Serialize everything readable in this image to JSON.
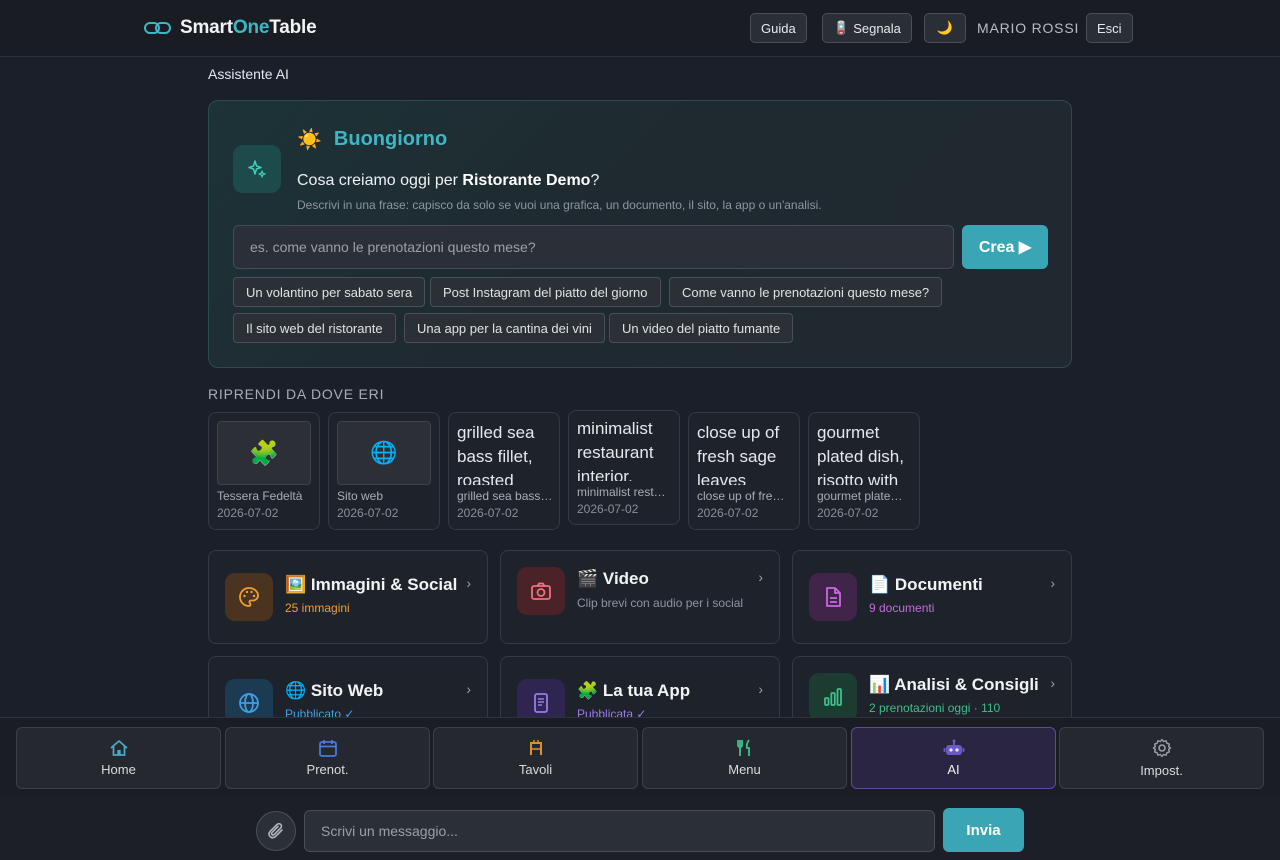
{
  "header": {
    "brand_a": "Smart",
    "brand_b": "One",
    "brand_c": "Table",
    "guide_label": "Guida",
    "report_icon": "🪫",
    "report_label": "Segnala",
    "theme_icon": "🌙",
    "user_name": "MARIO ROSSI",
    "logout_label": "Esci"
  },
  "page_title": "Assistente AI",
  "hero": {
    "greet_icon": "☀️",
    "greeting": "Buongiorno",
    "question_pre": "Cosa creiamo oggi per ",
    "restaurant": "Ristorante Demo",
    "question_post": "?",
    "subtitle": "Descrivi in una frase: capisco da solo se vuoi una grafica, un documento, il sito, la app o un'analisi.",
    "input_placeholder": "es. come vanno le prenotazioni questo mese?",
    "create_label": "Crea ▶",
    "suggestions": [
      "Un volantino per sabato sera",
      "Post Instagram del piatto del giorno",
      "Come vanno le prenotazioni questo mese?",
      "Il sito web del ristorante",
      "Una app per la cantina dei vini",
      "Un video del piatto fumante"
    ]
  },
  "recent": {
    "label": "RIPRENDI DA DOVE ERI",
    "items": [
      {
        "icon": "🧩",
        "name": "Tessera Fedeltà",
        "date": "2026-07-02"
      },
      {
        "icon": "🌐",
        "name": "Sito web",
        "date": "2026-07-02"
      },
      {
        "alt": "grilled sea bass fillet, roasted",
        "name": "grilled sea bass…",
        "date": "2026-07-02"
      },
      {
        "alt": "minimalist restaurant interior, sage",
        "name": "minimalist rest…",
        "date": "2026-07-02"
      },
      {
        "alt": "close up of fresh sage leaves",
        "name": "close up of fre…",
        "date": "2026-07-02"
      },
      {
        "alt": "gourmet plated dish, risotto with",
        "name": "gourmet plate…",
        "date": "2026-07-02"
      }
    ]
  },
  "categories": [
    {
      "emoji": "🖼️",
      "title": "Immagini & Social",
      "sub": "25 immagini",
      "sub_color": "#f0a030",
      "icon": "palette-icon"
    },
    {
      "emoji": "🎬",
      "title": "Video",
      "sub": "Clip brevi con audio per i social",
      "sub_color": "#8f959f",
      "icon": "camera-icon"
    },
    {
      "emoji": "📄",
      "title": "Documenti",
      "sub": "9 documenti",
      "sub_color": "#c86adf",
      "icon": "document-icon"
    },
    {
      "emoji": "🌐",
      "title": "Sito Web",
      "sub": "Pubblicato ✓",
      "sub_color": "#3f9fe0",
      "icon": "globe-icon"
    },
    {
      "emoji": "🧩",
      "title": "La tua App",
      "sub": "Pubblicata ✓",
      "sub_color": "#9a7ce8",
      "icon": "phone-icon"
    },
    {
      "emoji": "📊",
      "title": "Analisi & Consigli",
      "sub": "2 prenotazioni oggi · 110",
      "sub_color": "#3fbf8a",
      "icon": "bar-chart-icon"
    }
  ],
  "nav": [
    {
      "label": "Home",
      "icon": "home-icon"
    },
    {
      "label": "Prenot.",
      "icon": "calendar-icon"
    },
    {
      "label": "Tavoli",
      "icon": "table-icon"
    },
    {
      "label": "Menu",
      "icon": "fork-knife-icon"
    },
    {
      "label": "AI",
      "icon": "robot-icon"
    },
    {
      "label": "Impost.",
      "icon": "gear-icon"
    }
  ],
  "chat": {
    "placeholder": "Scrivi un messaggio...",
    "send_label": "Invia"
  },
  "colors": {
    "accent": "#3aa6b5",
    "active_nav": "#5a49a8"
  }
}
